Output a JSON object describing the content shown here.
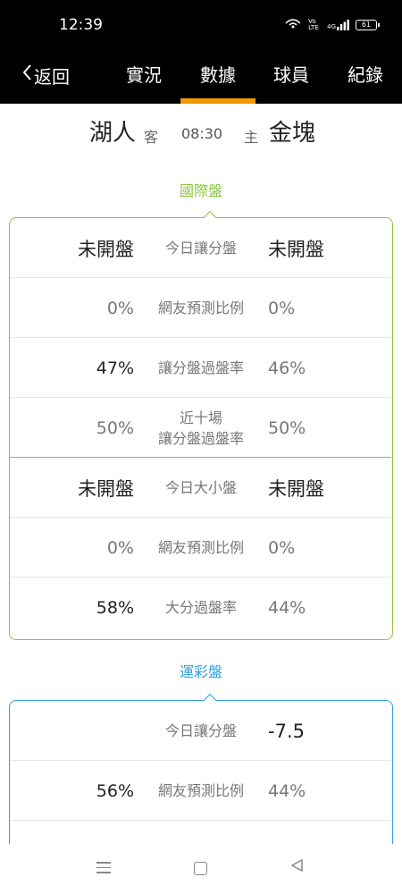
{
  "status_bar": {
    "time": "12:39",
    "icons": [
      "wifi-signal-icon",
      "volte-icon",
      "4g-signal-icon"
    ],
    "network": "4G",
    "volte": "Vo LTE",
    "battery": "61"
  },
  "nav": {
    "back_label": "返回",
    "tabs": [
      "實況",
      "數據",
      "球員",
      "紀錄"
    ],
    "active_tab": "數據",
    "accent_color": "#f39800"
  },
  "match": {
    "away_team": "湖人",
    "away_tag": "客",
    "time": "08:30",
    "home_tag": "主",
    "home_team": "金塊"
  },
  "international": {
    "title": "國際盤",
    "color": "#8cc43f",
    "rows": [
      {
        "left": "未開盤",
        "label": "今日讓分盤",
        "right": "未開盤"
      },
      {
        "left": "0%",
        "label": "網友預測比例",
        "right": "0%"
      },
      {
        "left": "47%",
        "label": "讓分盤過盤率",
        "right": "46%"
      },
      {
        "left": "50%",
        "label": "近十場\n讓分盤過盤率",
        "right": "50%"
      },
      {
        "left": "未開盤",
        "label": "今日大小盤",
        "right": "未開盤"
      },
      {
        "left": "0%",
        "label": "網友預測比例",
        "right": "0%"
      },
      {
        "left": "58%",
        "label": "大分過盤率",
        "right": "44%"
      }
    ]
  },
  "sports_lottery": {
    "title": "運彩盤",
    "color": "#2e9fe0",
    "rows": [
      {
        "left": "",
        "label": "今日讓分盤",
        "right": "-7.5"
      },
      {
        "left": "56%",
        "label": "網友預測比例",
        "right": "44%"
      }
    ]
  },
  "bottom_nav": {
    "icons": [
      "menu-icon",
      "home-icon",
      "back-icon"
    ]
  }
}
